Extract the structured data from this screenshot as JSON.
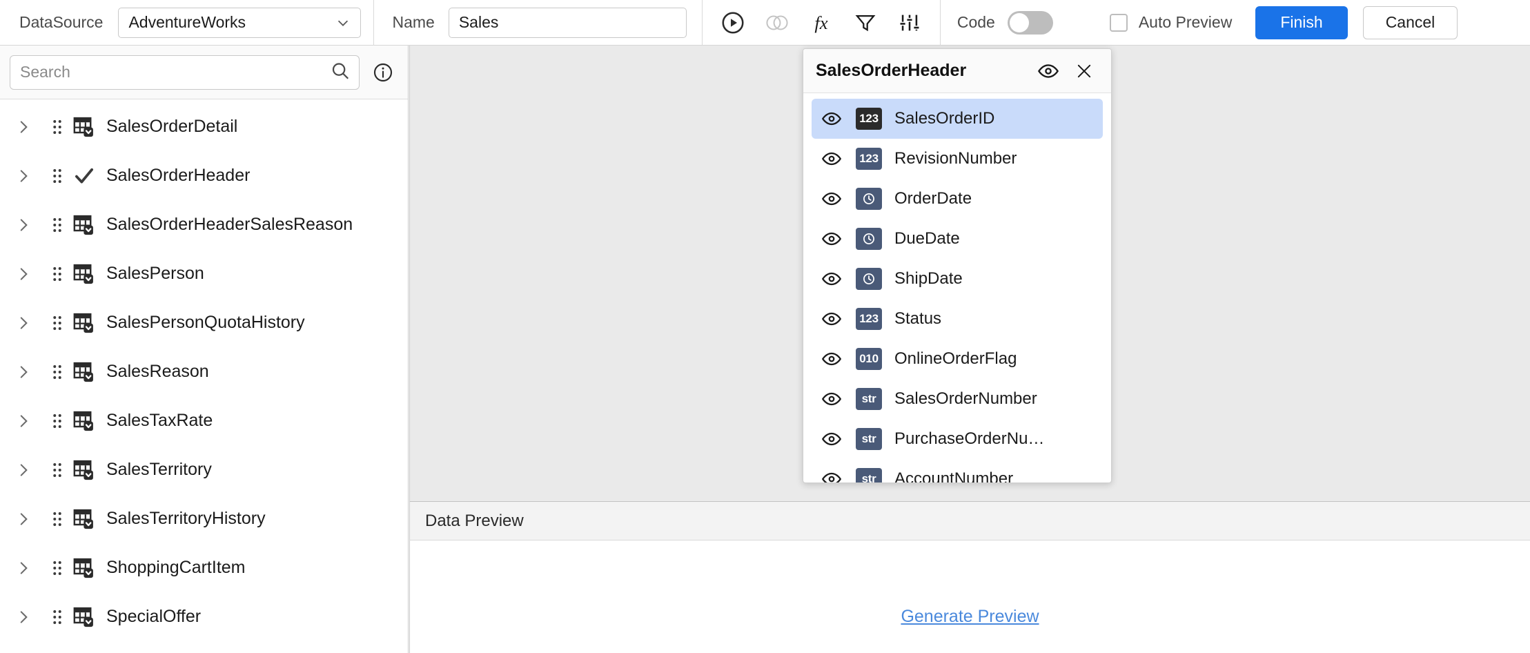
{
  "toolbar": {
    "datasource_label": "DataSource",
    "datasource_value": "AdventureWorks",
    "name_label": "Name",
    "name_value": "Sales",
    "run_icon": "run-play-icon",
    "join_icon": "join-venn-icon",
    "function_icon": "fx-function-icon",
    "filter_icon": "filter-funnel-icon",
    "settings_icon": "sliders-settings-icon",
    "code_label": "Code",
    "code_toggle_state": "off",
    "auto_preview_label": "Auto Preview",
    "auto_preview_checked": false,
    "finish_label": "Finish",
    "cancel_label": "Cancel",
    "accent_color": "#1a73e8"
  },
  "sidebar": {
    "search_placeholder": "Search",
    "search_value": "",
    "search_icon": "search-icon",
    "info_icon": "info-circle-icon",
    "tables": [
      {
        "label": "SalesOrderDetail",
        "icon": "table-dropdown-icon",
        "selected": false
      },
      {
        "label": "SalesOrderHeader",
        "icon": "check-icon",
        "selected": true
      },
      {
        "label": "SalesOrderHeaderSalesReason",
        "icon": "table-dropdown-icon",
        "selected": false
      },
      {
        "label": "SalesPerson",
        "icon": "table-dropdown-icon",
        "selected": false
      },
      {
        "label": "SalesPersonQuotaHistory",
        "icon": "table-dropdown-icon",
        "selected": false
      },
      {
        "label": "SalesReason",
        "icon": "table-dropdown-icon",
        "selected": false
      },
      {
        "label": "SalesTaxRate",
        "icon": "table-dropdown-icon",
        "selected": false
      },
      {
        "label": "SalesTerritory",
        "icon": "table-dropdown-icon",
        "selected": false
      },
      {
        "label": "SalesTerritoryHistory",
        "icon": "table-dropdown-icon",
        "selected": false
      },
      {
        "label": "ShoppingCartItem",
        "icon": "table-dropdown-icon",
        "selected": false
      },
      {
        "label": "SpecialOffer",
        "icon": "table-dropdown-icon",
        "selected": false
      }
    ]
  },
  "field_panel": {
    "title": "SalesOrderHeader",
    "eye_icon": "eye-visibility-icon",
    "close_icon": "close-x-icon",
    "fields": [
      {
        "name": "SalesOrderID",
        "type": "123",
        "selected": true
      },
      {
        "name": "RevisionNumber",
        "type": "123",
        "selected": false
      },
      {
        "name": "OrderDate",
        "type": "date",
        "selected": false
      },
      {
        "name": "DueDate",
        "type": "date",
        "selected": false
      },
      {
        "name": "ShipDate",
        "type": "date",
        "selected": false
      },
      {
        "name": "Status",
        "type": "123",
        "selected": false
      },
      {
        "name": "OnlineOrderFlag",
        "type": "010",
        "selected": false
      },
      {
        "name": "SalesOrderNumber",
        "type": "str",
        "selected": false
      },
      {
        "name": "PurchaseOrderNu…",
        "type": "str",
        "selected": false
      },
      {
        "name": "AccountNumber",
        "type": "str",
        "selected": false
      }
    ]
  },
  "preview": {
    "header_label": "Data Preview",
    "generate_label": "Generate Preview",
    "link_color": "#4a89dc"
  }
}
